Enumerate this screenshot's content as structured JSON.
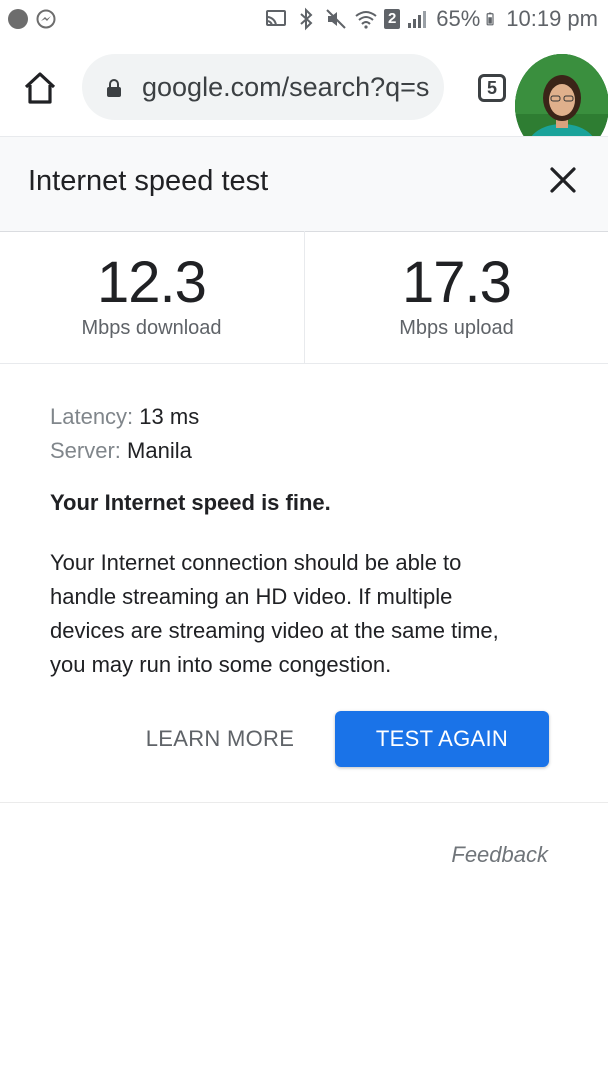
{
  "status_bar": {
    "battery": "65%",
    "time": "10:19 pm",
    "sim_badge": "2",
    "icons": [
      "record-dot-icon",
      "messenger-icon",
      "cast-icon",
      "bluetooth-icon",
      "mute-icon",
      "wifi-icon",
      "signal-icon",
      "battery-icon"
    ]
  },
  "browser": {
    "url": "google.com/search?q=s",
    "tab_count": "5",
    "icons": [
      "home-icon",
      "lock-icon",
      "tabs-icon",
      "avatar"
    ]
  },
  "widget": {
    "title": "Internet speed test",
    "download_value": "12.3",
    "download_unit": "Mbps download",
    "upload_value": "17.3",
    "upload_unit": "Mbps upload",
    "latency_label": "Latency:",
    "latency_value": "13 ms",
    "server_label": "Server:",
    "server_value": "Manila",
    "verdict": "Your Internet speed is fine.",
    "description_lines": [
      "Your Internet connection should be able to",
      "handle streaming an HD video. If multiple",
      "devices are streaming video at the same time,",
      "you may run into some congestion."
    ],
    "learn_more": "LEARN MORE",
    "test_again": "TEST AGAIN",
    "feedback": "Feedback"
  },
  "colors": {
    "primary": "#1a73e8",
    "text": "#202124",
    "muted": "#5f6368"
  }
}
